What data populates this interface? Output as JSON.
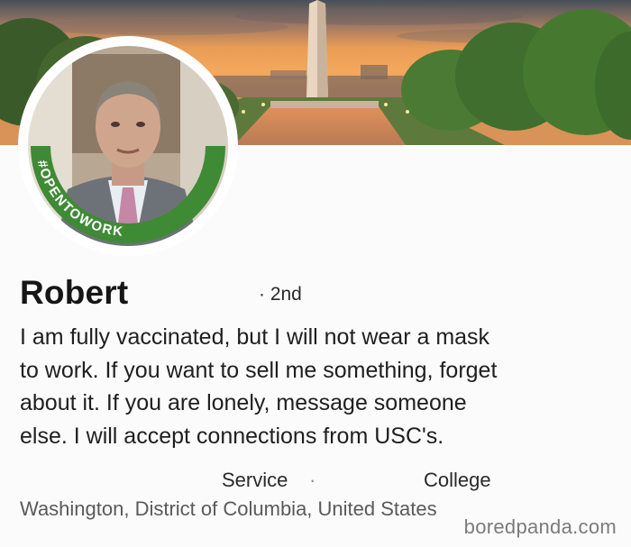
{
  "profile": {
    "name": "Robert",
    "connection_degree": "· 2nd",
    "headline_lines": [
      "I am fully vaccinated, but I will not wear a mask",
      "to work. If you want to sell me something, forget",
      "about it.  If you are lonely, message someone",
      "else.  I will accept connections from USC's."
    ],
    "experience_label": "Service",
    "separator": "·",
    "education_label": "College",
    "location": "Washington, District of Columbia, United States"
  },
  "avatar_frame": {
    "badge_text": "#OPENTOWORK",
    "badge_color": "#3f8a35"
  },
  "cover": {
    "scene": "washington-monument-sunset"
  },
  "watermark": "boredpanda.com"
}
